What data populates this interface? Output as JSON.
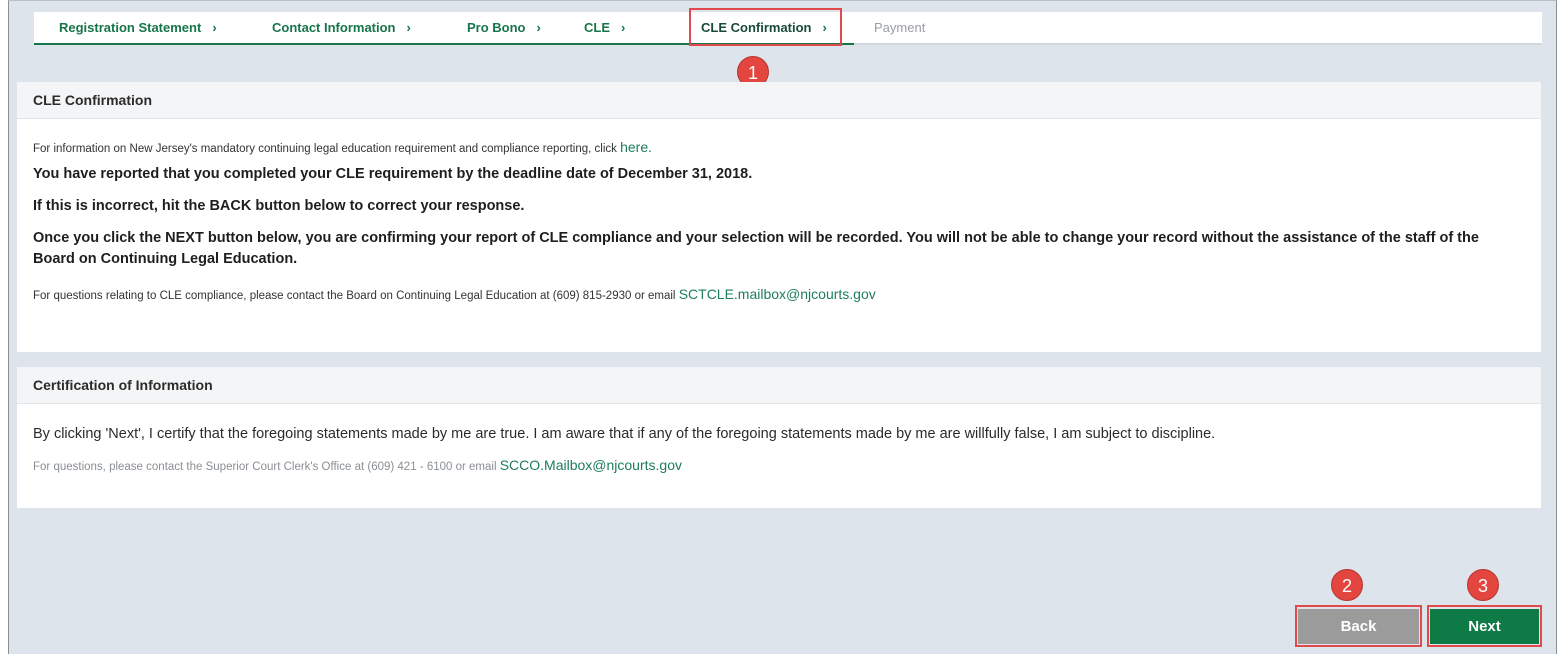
{
  "breadcrumb": [
    {
      "label": "Registration Statement",
      "state": "done"
    },
    {
      "label": "Contact Information",
      "state": "done"
    },
    {
      "label": "Pro Bono",
      "state": "done"
    },
    {
      "label": "CLE",
      "state": "done"
    },
    {
      "label": "CLE Confirmation",
      "state": "current"
    },
    {
      "label": "Payment",
      "state": "pending"
    }
  ],
  "chevron": "›",
  "annotations": {
    "one": "1",
    "two": "2",
    "three": "3"
  },
  "cle_panel": {
    "title": "CLE Confirmation",
    "info_prefix": "For information on New Jersey's mandatory continuing legal education requirement and compliance reporting, click ",
    "info_link": "here.",
    "line1": "You have reported that you completed your CLE requirement by the deadline date of December 31, 2018.",
    "line2": "If this is incorrect, hit the BACK button below to correct your response.",
    "line3": "Once you click the NEXT button below, you are confirming your report of CLE compliance and your selection will be recorded. You will not be able to change your record without the assistance of the staff of the Board on Continuing Legal Education.",
    "contact_prefix": "For questions relating to CLE compliance, please contact the Board on Continuing Legal Education at (609) 815-2930 or email ",
    "contact_email": "SCTCLE.mailbox@njcourts.gov"
  },
  "cert_panel": {
    "title": "Certification of Information",
    "statement": "By clicking 'Next', I certify that the foregoing statements made by me are true. I am aware that if any of the foregoing statements made by me are willfully false, I am subject to discipline.",
    "contact_prefix": "For questions, please contact the Superior Court Clerk's Office at (609) 421 - 6100 or email ",
    "contact_email": "SCCO.Mailbox@njcourts.gov"
  },
  "buttons": {
    "back": "Back",
    "next": "Next"
  },
  "colors": {
    "accent": "#16754a",
    "next_button": "#0e7a45",
    "back_button": "#9b9b9b",
    "annotation": "#e3463f"
  }
}
